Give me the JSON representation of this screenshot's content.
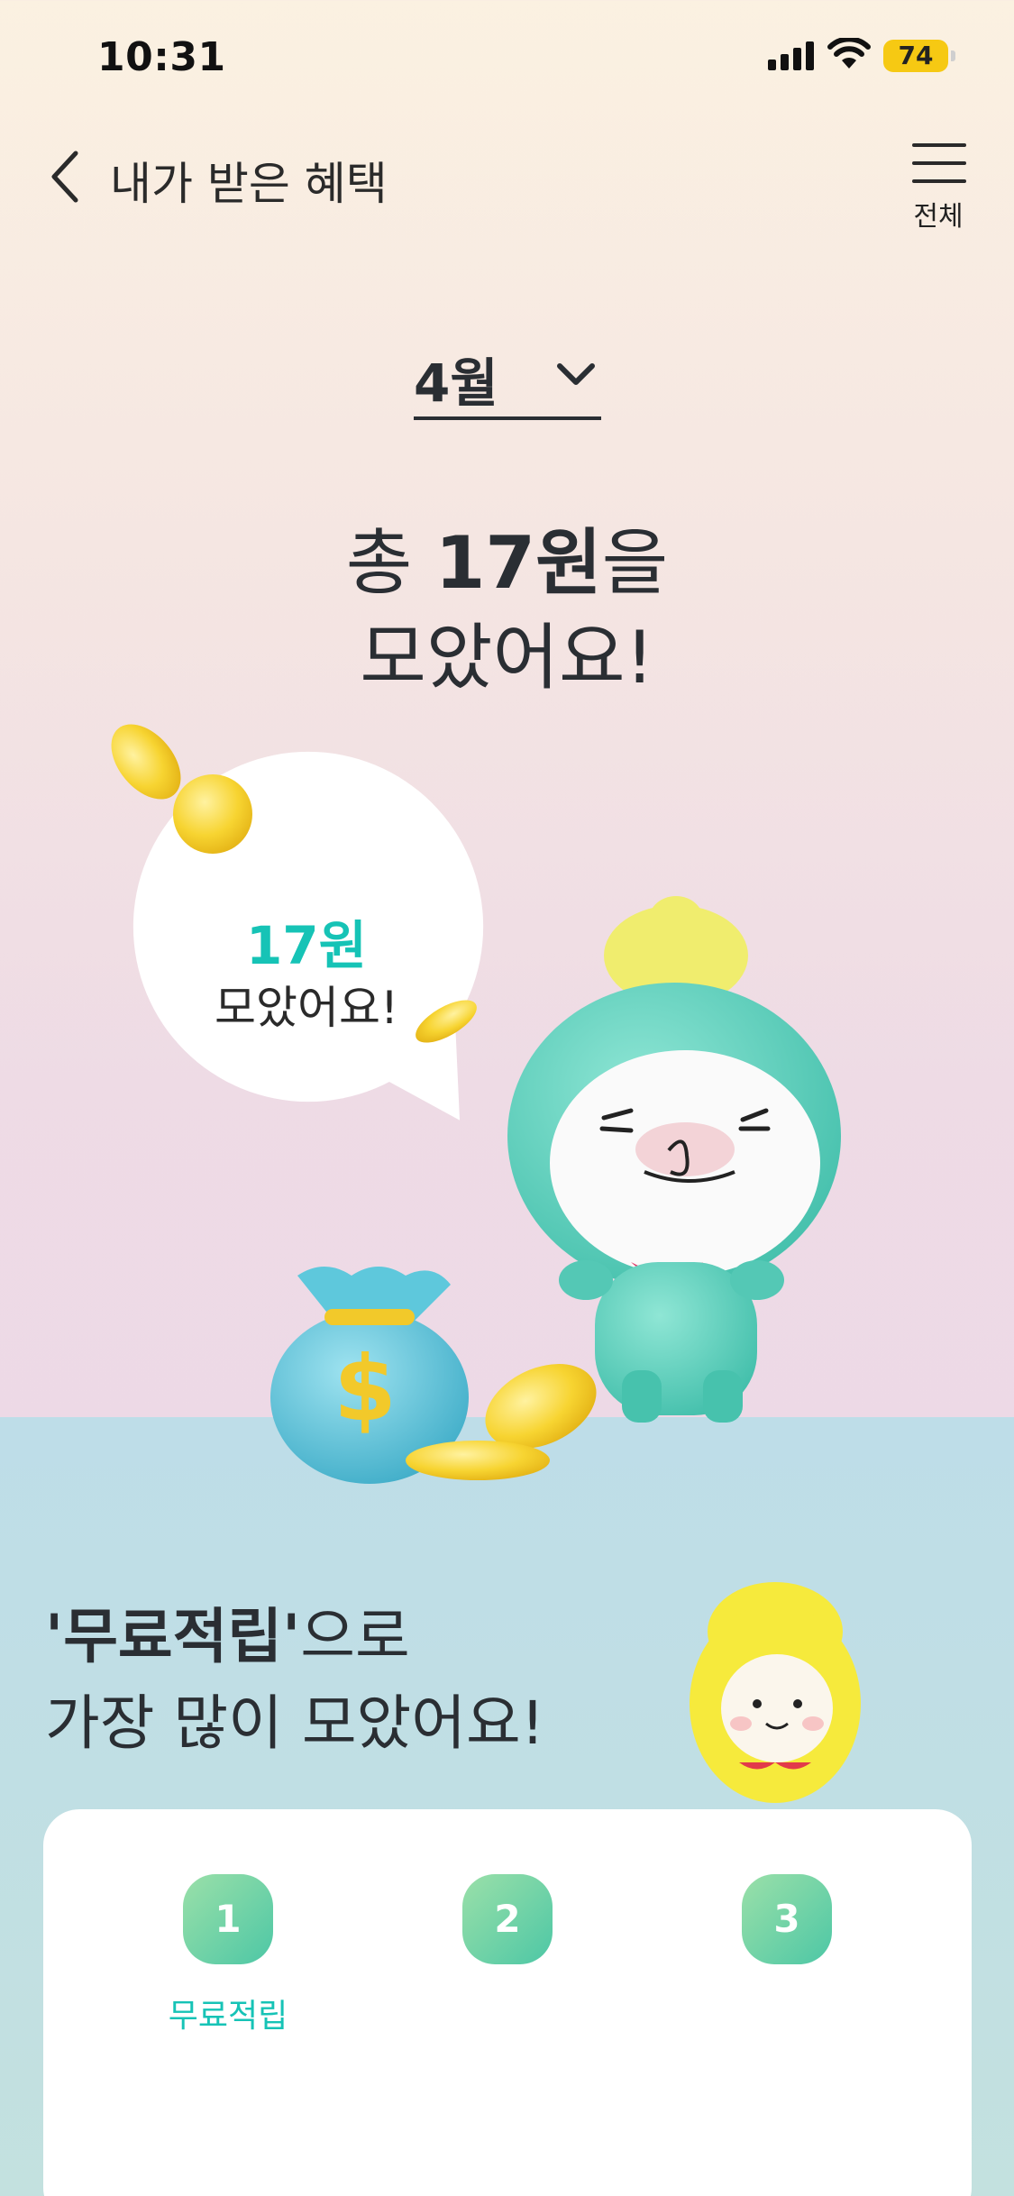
{
  "status_bar": {
    "time": "10:31",
    "battery": "74",
    "icons": [
      "signal-icon",
      "wifi-icon",
      "battery-icon"
    ]
  },
  "header": {
    "back_icon": "chevron-left-icon",
    "title": "내가 받은 혜택",
    "menu_icon": "hamburger-icon",
    "menu_label": "전체"
  },
  "month_selector": {
    "value": "4월",
    "icon": "chevron-down-icon"
  },
  "summary": {
    "prefix": "총 ",
    "amount": "17원",
    "suffix": "을",
    "line2": "모았어요!"
  },
  "bubble": {
    "amount": "17원",
    "text": "모았어요!"
  },
  "top_method": {
    "highlight": "'무료적립'",
    "line1_rest": "으로",
    "line2": "가장 많이 모았어요!"
  },
  "ranking": [
    {
      "rank": "1",
      "label": "무료적립"
    },
    {
      "rank": "2",
      "label": ""
    },
    {
      "rank": "3",
      "label": ""
    }
  ],
  "colors": {
    "accent": "#16c3b6",
    "badge_start": "#9be0a8",
    "badge_end": "#4dc7a6",
    "text_dark": "#2a2e33",
    "bottom_bg": "#bedde8"
  }
}
